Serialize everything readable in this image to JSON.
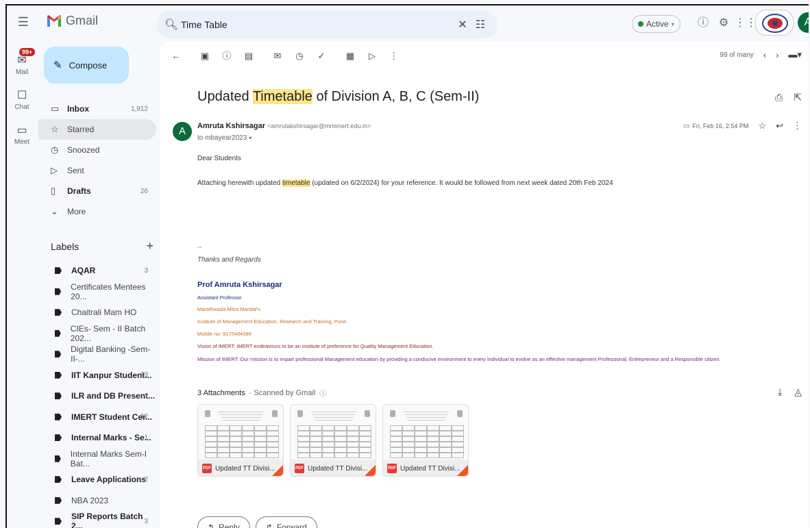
{
  "app": {
    "name": "Gmail"
  },
  "search": {
    "query": "Time Table"
  },
  "status": {
    "label": "Active"
  },
  "rail": {
    "mail_label": "Mail",
    "mail_badge": "99+",
    "chat_label": "Chat",
    "meet_label": "Meet"
  },
  "compose_label": "Compose",
  "nav": [
    {
      "label": "Inbox",
      "count": "1,912",
      "icon": "inbox-icon",
      "bold": true
    },
    {
      "label": "Starred",
      "count": "",
      "icon": "star-icon",
      "bold": false,
      "selected": true
    },
    {
      "label": "Snoozed",
      "count": "",
      "icon": "clock-icon",
      "bold": false
    },
    {
      "label": "Sent",
      "count": "",
      "icon": "send-icon",
      "bold": false
    },
    {
      "label": "Drafts",
      "count": "26",
      "icon": "draft-icon",
      "bold": true
    },
    {
      "label": "More",
      "count": "",
      "icon": "chevron-down-icon",
      "bold": false
    }
  ],
  "labels_header": "Labels",
  "labels": [
    {
      "label": "AQAR",
      "count": "3",
      "bold": true
    },
    {
      "label": "Certificates Mentees 20...",
      "count": "",
      "bold": false
    },
    {
      "label": "Chaitrali Mam HO",
      "count": "",
      "bold": false
    },
    {
      "label": "CIEs- Sem - II Batch 202...",
      "count": "",
      "bold": false
    },
    {
      "label": "Digital Banking -Sem-II-...",
      "count": "",
      "bold": false
    },
    {
      "label": "IIT Kanpur Student...",
      "count": "23",
      "bold": true
    },
    {
      "label": "ILR and DB Present...",
      "count": "1",
      "bold": true
    },
    {
      "label": "IMERT Student Cer...",
      "count": "12",
      "bold": true
    },
    {
      "label": "Internal Marks - Se...",
      "count": "1",
      "bold": true
    },
    {
      "label": "Internal Marks Sem-I Bat...",
      "count": "",
      "bold": false
    },
    {
      "label": "Leave Applications",
      "count": "2",
      "bold": true
    },
    {
      "label": "NBA 2023",
      "count": "",
      "bold": false
    },
    {
      "label": "SIP Reports Batch 2...",
      "count": "3",
      "bold": true
    }
  ],
  "pager": {
    "text": "99 of many"
  },
  "email": {
    "subject_pre": "Updated ",
    "subject_hl": "Timetable",
    "subject_post": " of Division A, B, C (Sem-II)",
    "sender_name": "Amruta Kshirsagar",
    "sender_email": "<amrutakshirsagar@mmimert.edu.in>",
    "to": "to mbayear2023",
    "date": "Fri, Feb 16, 2:54 PM",
    "greeting": "Dear Students",
    "body_pre": "Attaching herewith updated ",
    "body_hl": "timetable",
    "body_post": " (updated on 6/2/2024) for your reference. It would be followed from next week dated 20th Feb 2024",
    "sig_dash": "--",
    "thanks": "Thanks and Regards",
    "sig_name": "Prof Amruta Kshirsagar",
    "sig_title": "Assistant Professor",
    "sig_org": "Marathwada Mitra Mandal's",
    "sig_inst": "Institute of Management Education, Research and Training, Pune.",
    "sig_mobile": "Mobile no- 9175484399",
    "sig_vision": "Vision of IMERT: IMERT endeavours to be an institute of preference for Quality Management Education.",
    "sig_mission": "Mission of IMERT: Our mission is to impart professional Management education by providing a conducive environment to every individual to evolve as an effective management Professional, Entrepreneur and a Responsible citizen."
  },
  "attachments": {
    "header": "3 Attachments",
    "scanned": "· Scanned by Gmail",
    "files": [
      {
        "name": "Updated TT Divisi..."
      },
      {
        "name": "Updated TT Divisi..."
      },
      {
        "name": "Updated TT Divisi..."
      }
    ]
  },
  "actions": {
    "reply": "Reply",
    "forward": "Forward"
  },
  "colors": {
    "compose_bg": "#c2e7ff",
    "search_bg": "#eaf1fb",
    "highlight": "#fde68a",
    "avatar": "#0b6b3a",
    "badge": "#c5221f",
    "sig_name": "#1a2c7a",
    "sig_org": "#c7711c",
    "sig_vision": "#8b2a2a",
    "sig_mission": "#6d2a6d"
  }
}
